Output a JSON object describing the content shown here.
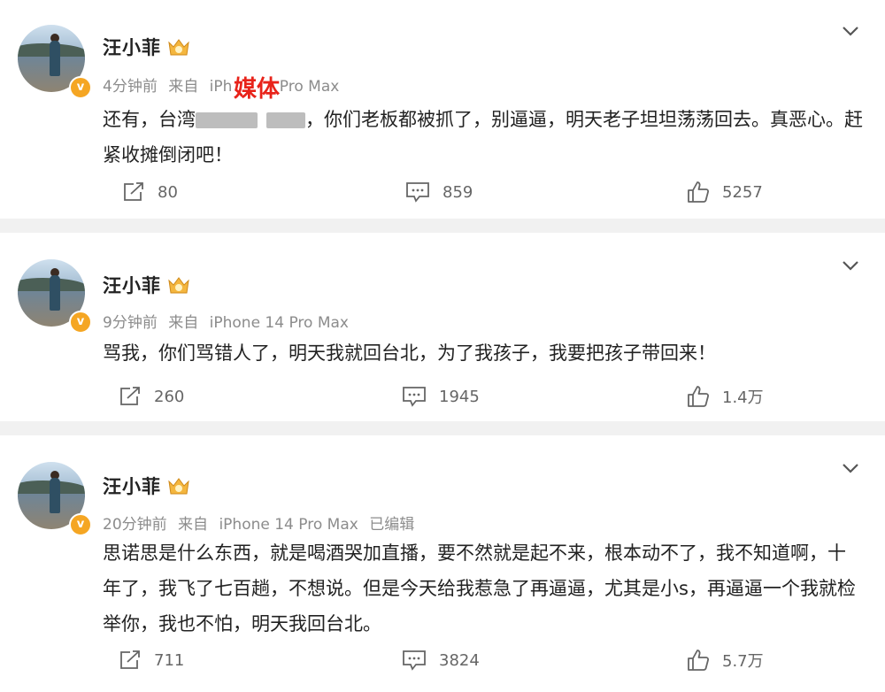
{
  "posts": [
    {
      "name": "汪小菲",
      "time": "4分钟前",
      "source_prefix": "来自",
      "device": "iPh",
      "device_tail": "Pro Max",
      "overlay_label": "媒体",
      "text_before": "还有，台湾",
      "text_after": "，你们老板都被抓了，别逼逼，明天老子坦坦荡荡回去。真恶心。赶紧收摊倒闭吧！",
      "repost": "80",
      "comment": "859",
      "like": "5257"
    },
    {
      "name": "汪小菲",
      "time": "9分钟前",
      "source_prefix": "来自",
      "device": "iPhone 14 Pro Max",
      "text": "骂我，你们骂错人了，明天我就回台北，为了我孩子，我要把孩子带回来！",
      "repost": "260",
      "comment": "1945",
      "like": "1.4万"
    },
    {
      "name": "汪小菲",
      "time": "20分钟前",
      "source_prefix": "来自",
      "device": "iPhone 14 Pro Max",
      "edited": "已编辑",
      "text": "思诺思是什么东西，就是喝酒哭加直播，要不然就是起不来，根本动不了，我不知道啊，十年了，我飞了七百趟，不想说。但是今天给我惹急了再逼逼，尤其是小s，再逼逼一个我就检举你，我也不怕，明天我回台北。",
      "repost": "711",
      "comment": "3824",
      "like": "5.7万"
    }
  ],
  "icons": {
    "verified": "verified-badge-icon",
    "member": "crown-member-icon",
    "more": "chevron-down-icon",
    "repost": "repost-icon",
    "comment": "comment-icon",
    "like": "thumbs-up-icon"
  },
  "colors": {
    "verified": "#f5a623",
    "overlay_label": "#e8231a",
    "meta": "#8c8c8c",
    "text": "#222222",
    "background": "#f1f1f1"
  }
}
